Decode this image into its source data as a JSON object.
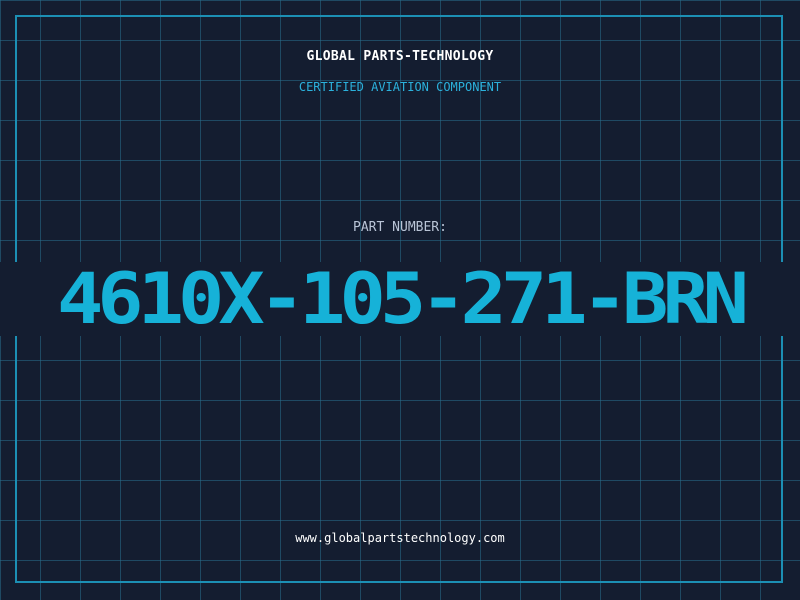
{
  "header": {
    "brand": "GLOBAL PARTS-TECHNOLOGY",
    "tagline": "CERTIFIED AVIATION COMPONENT"
  },
  "part": {
    "label": "PART NUMBER:",
    "number": "4610X-105-271-BRN"
  },
  "footer": {
    "website": "www.globalpartstechnology.com"
  },
  "colors": {
    "background": "#141d30",
    "grid": "#286e8c",
    "frame": "#1c8fb4",
    "accent": "#16b2d8",
    "label": "#b9c4d6"
  }
}
